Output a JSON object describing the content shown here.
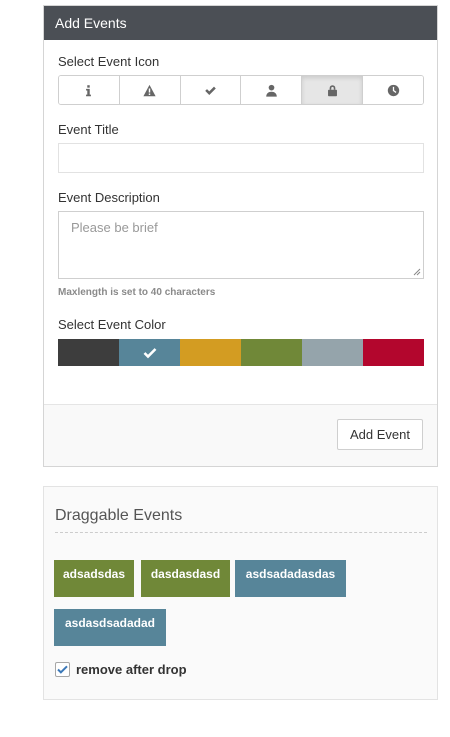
{
  "add_panel": {
    "title": "Add Events",
    "icon_label": "Select Event Icon",
    "icons": [
      {
        "name": "info-icon",
        "active": false
      },
      {
        "name": "warning-icon",
        "active": false
      },
      {
        "name": "check-icon",
        "active": false
      },
      {
        "name": "user-icon",
        "active": false
      },
      {
        "name": "lock-icon",
        "active": true
      },
      {
        "name": "clock-icon",
        "active": false
      }
    ],
    "title_label": "Event Title",
    "title_value": "",
    "desc_label": "Event Description",
    "desc_placeholder": "Please be brief",
    "hint": "Maxlength is set to 40 characters",
    "color_label": "Select Event Color",
    "colors": [
      "#3d3d3d",
      "#578599",
      "#d39c22",
      "#708838",
      "#95a4ab",
      "#b3062d"
    ],
    "selected_color_index": 1,
    "add_button": "Add Event"
  },
  "drag_panel": {
    "title": "Draggable Events",
    "events": [
      {
        "label": "adsadsdas",
        "color": "#708838"
      },
      {
        "label": "dasdasdasd",
        "color": "#708838"
      },
      {
        "label": "asdsadadasdas",
        "color": "#578599"
      },
      {
        "label": "asdasdsadadad",
        "color": "#578599"
      }
    ],
    "remove_after_drop_label": "remove after drop",
    "remove_after_drop_checked": true
  }
}
